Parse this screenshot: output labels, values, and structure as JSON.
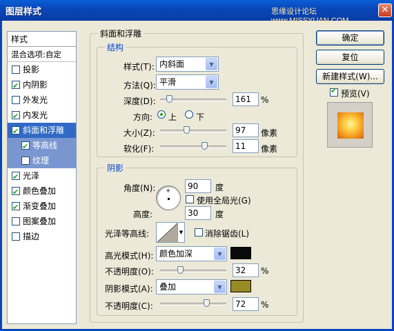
{
  "window": {
    "title": "图层样式",
    "watermark": "思缘设计论坛 www.MISSYUAN.COM",
    "close_label": "✕"
  },
  "sidebar": {
    "header": "样式",
    "blend_options": "混合选项:自定",
    "items": [
      {
        "label": "投影",
        "checked": false
      },
      {
        "label": "内阴影",
        "checked": true
      },
      {
        "label": "外发光",
        "checked": false
      },
      {
        "label": "内发光",
        "checked": true
      },
      {
        "label": "斜面和浮雕",
        "checked": true,
        "selected": true
      },
      {
        "label": "等高线",
        "checked": true,
        "sub": true
      },
      {
        "label": "纹理",
        "checked": false,
        "sub": true
      },
      {
        "label": "光泽",
        "checked": true
      },
      {
        "label": "颜色叠加",
        "checked": true
      },
      {
        "label": "渐变叠加",
        "checked": true
      },
      {
        "label": "图案叠加",
        "checked": false
      },
      {
        "label": "描边",
        "checked": false
      }
    ]
  },
  "bevel": {
    "group_title": "斜面和浮雕",
    "structure": {
      "title": "结构",
      "style_label": "样式(T):",
      "style_value": "内斜面",
      "technique_label": "方法(Q):",
      "technique_value": "平滑",
      "depth_label": "深度(D):",
      "depth_value": "161",
      "depth_unit": "%",
      "direction_label": "方向:",
      "dir_up": "上",
      "dir_down": "下",
      "size_label": "大小(Z):",
      "size_value": "97",
      "size_unit": "像素",
      "soften_label": "软化(F):",
      "soften_value": "11",
      "soften_unit": "像素"
    },
    "shading": {
      "title": "阴影",
      "angle_label": "角度(N):",
      "angle_value": "90",
      "angle_unit": "度",
      "global_light_label": "使用全局光(G)",
      "altitude_label": "高度:",
      "altitude_value": "30",
      "altitude_unit": "度",
      "gloss_contour_label": "光泽等高线:",
      "anti_alias_label": "消除锯齿(L)",
      "highlight_mode_label": "高光模式(H):",
      "highlight_mode_value": "颜色加深",
      "highlight_color": "#0a0a0a",
      "highlight_opacity_label": "不透明度(O):",
      "highlight_opacity_value": "32",
      "shadow_mode_label": "阴影模式(A):",
      "shadow_mode_value": "叠加",
      "shadow_color": "#9a8a24",
      "shadow_opacity_label": "不透明度(C):",
      "shadow_opacity_value": "72",
      "percent": "%"
    }
  },
  "buttons": {
    "ok": "确定",
    "reset": "复位",
    "new_style": "新建样式(W)...",
    "preview_label": "预览(V)"
  }
}
